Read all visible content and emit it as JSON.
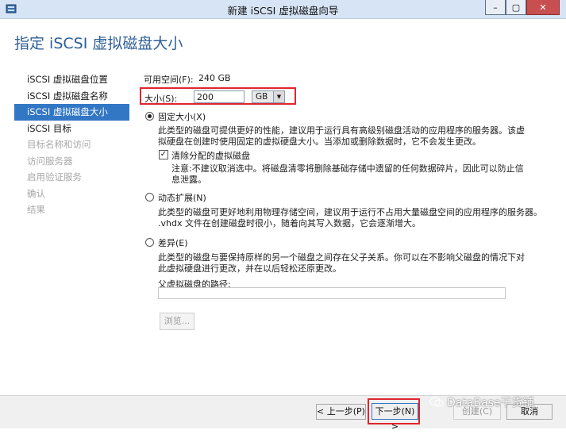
{
  "window": {
    "title": "新建 iSCSI 虚拟磁盘向导",
    "buttons": {
      "minimize": "–",
      "maximize": "▢",
      "close": "✕"
    }
  },
  "header": {
    "title": "指定 iSCSI 虚拟磁盘大小"
  },
  "nav": {
    "items": [
      {
        "label": "iSCSI 虚拟磁盘位置",
        "state": "normal"
      },
      {
        "label": "iSCSI 虚拟磁盘名称",
        "state": "normal"
      },
      {
        "label": "iSCSI 虚拟磁盘大小",
        "state": "active"
      },
      {
        "label": "iSCSI 目标",
        "state": "normal"
      },
      {
        "label": "目标名称和访问",
        "state": "disabled"
      },
      {
        "label": "访问服务器",
        "state": "disabled"
      },
      {
        "label": "启用验证服务",
        "state": "disabled"
      },
      {
        "label": "确认",
        "state": "disabled"
      },
      {
        "label": "结果",
        "state": "disabled"
      }
    ]
  },
  "size": {
    "available_label": "可用空间(F):",
    "available_value": "240 GB",
    "size_label": "大小(S):",
    "size_value": "200",
    "unit": "GB"
  },
  "options": {
    "fixed": {
      "label": "固定大小(X)",
      "checked": true,
      "desc_line1": "此类型的磁盘可提供更好的性能，建议用于运行具有高级别磁盘活动的应用程序的服务器。该虚",
      "desc_line2": "拟硬盘在创建时使用固定的虚拟硬盘大小。当添加或删除数据时，它不会发生更改。",
      "clear_label": "清除分配的虚拟磁盘",
      "clear_checked": true,
      "clear_desc_line1": "注意:不建议取消选中。将磁盘清零将删除基础存储中遗留的任何数据碎片，因此可以防止信",
      "clear_desc_line2": "息泄露。"
    },
    "dynamic": {
      "label": "动态扩展(N)",
      "checked": false,
      "desc_line1": "此类型的磁盘可更好地利用物理存储空间，建议用于运行不占用大量磁盘空间的应用程序的服务器。",
      "desc_line2": ".vhdx 文件在创建磁盘时很小，随着向其写入数据，它会逐渐增大。"
    },
    "differencing": {
      "label": "差异(E)",
      "checked": false,
      "desc_line1": "此类型的磁盘与要保持原样的另一个磁盘之间存在父子关系。你可以在不影响父磁盘的情况下对",
      "desc_line2": "此虚拟硬盘进行更改，并在以后轻松还原更改。",
      "parent_path_label": "父虚拟磁盘的路径:",
      "parent_path_value": "",
      "browse_label": "浏览..."
    }
  },
  "footer": {
    "prev_label": "< 上一步(P)",
    "next_label": "下一步(N) >",
    "create_label": "创建(C)",
    "cancel_label": "取消"
  },
  "watermark": {
    "text": "DataBase干货铺"
  },
  "colors": {
    "accent": "#3277c4",
    "header": "#2f5f98",
    "highlight_box": "#e0262e"
  }
}
